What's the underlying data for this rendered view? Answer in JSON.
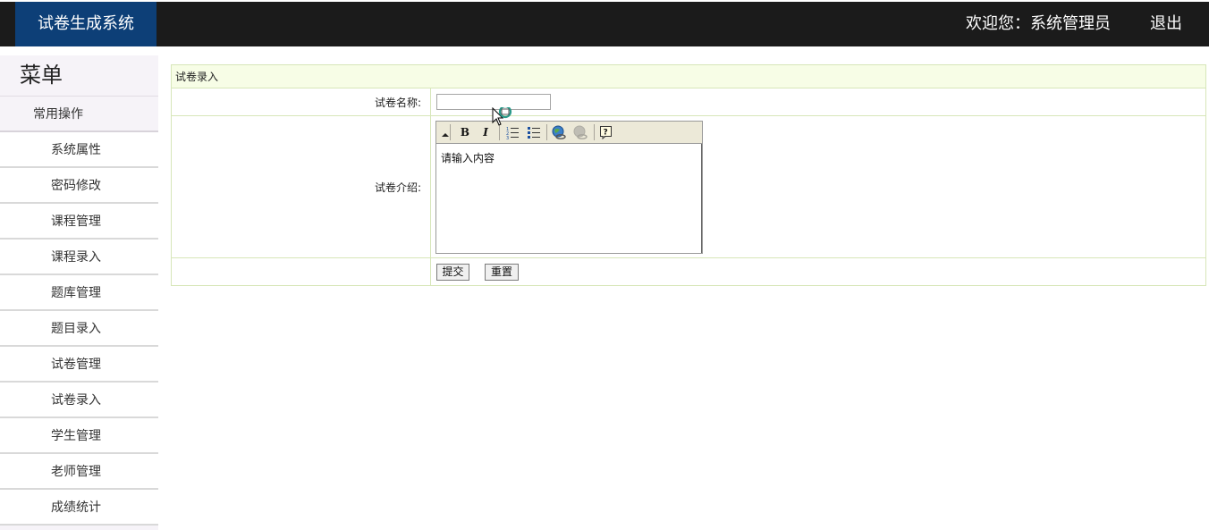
{
  "header": {
    "brand": "试卷生成系统",
    "welcome": "欢迎您：系统管理员",
    "logout": "退出"
  },
  "sidebar": {
    "title": "菜单",
    "group": "常用操作",
    "items": [
      {
        "label": "系统属性"
      },
      {
        "label": "密码修改"
      },
      {
        "label": "课程管理"
      },
      {
        "label": "课程录入"
      },
      {
        "label": "题库管理"
      },
      {
        "label": "题目录入"
      },
      {
        "label": "试卷管理"
      },
      {
        "label": "试卷录入"
      },
      {
        "label": "学生管理"
      },
      {
        "label": "老师管理"
      },
      {
        "label": "成绩统计"
      }
    ]
  },
  "form": {
    "title": "试卷录入",
    "name_label": "试卷名称:",
    "name_value": "",
    "intro_label": "试卷介绍:",
    "intro_content": "请输入内容",
    "submit": "提交",
    "reset": "重置"
  },
  "editor_toolbar": {
    "bold": "B",
    "italic": "I",
    "icons": [
      "collapse-icon",
      "bold-icon",
      "italic-icon",
      "ordered-list-icon",
      "unordered-list-icon",
      "insert-link-icon",
      "remove-link-icon",
      "help-icon"
    ]
  }
}
